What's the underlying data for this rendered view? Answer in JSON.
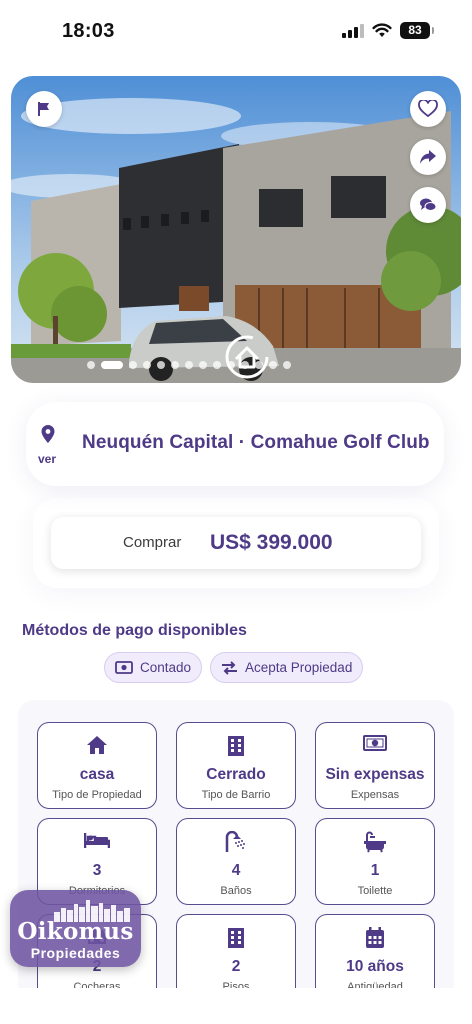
{
  "status_bar": {
    "time": "18:03",
    "battery": "83"
  },
  "gallery": {
    "total_images": 14,
    "current_index": 1,
    "actions": {
      "left": "flag-icon",
      "right": [
        "heart-icon",
        "share-icon",
        "chat-icon"
      ]
    }
  },
  "location": {
    "link_label": "ver",
    "text": "Neuquén Capital · Comahue Golf Club"
  },
  "price": {
    "operation": "Comprar",
    "amount": "US$ 399.000"
  },
  "payment_methods": {
    "title": "Métodos de pago disponibles",
    "options": [
      {
        "label": "Contado",
        "icon": "cash-icon"
      },
      {
        "label": "Acepta Propiedad",
        "icon": "swap-icon"
      }
    ]
  },
  "features": [
    {
      "value": "casa",
      "label": "Tipo de Propiedad",
      "icon": "home-icon"
    },
    {
      "value": "Cerrado",
      "label": "Tipo de Barrio",
      "icon": "building-icon"
    },
    {
      "value": "Sin expensas",
      "label": "Expensas",
      "icon": "money-icon"
    },
    {
      "value": "3",
      "label": "Dormitorios",
      "icon": "bed-icon"
    },
    {
      "value": "4",
      "label": "Baños",
      "icon": "shower-icon"
    },
    {
      "value": "1",
      "label": "Toilette",
      "icon": "bath-icon"
    },
    {
      "value": "2",
      "label": "Cocheras",
      "icon": "car-icon"
    },
    {
      "value": "2",
      "label": "Pisos",
      "icon": "building-icon"
    },
    {
      "value": "10 años",
      "label": "Antigüedad",
      "icon": "calendar-icon"
    }
  ],
  "brand": {
    "name": "Oikomus",
    "subtitle": "Propiedades"
  },
  "colors": {
    "accent": "#4e3a86",
    "chip_bg": "#f1ecfb",
    "border": "#5a4a8e"
  }
}
